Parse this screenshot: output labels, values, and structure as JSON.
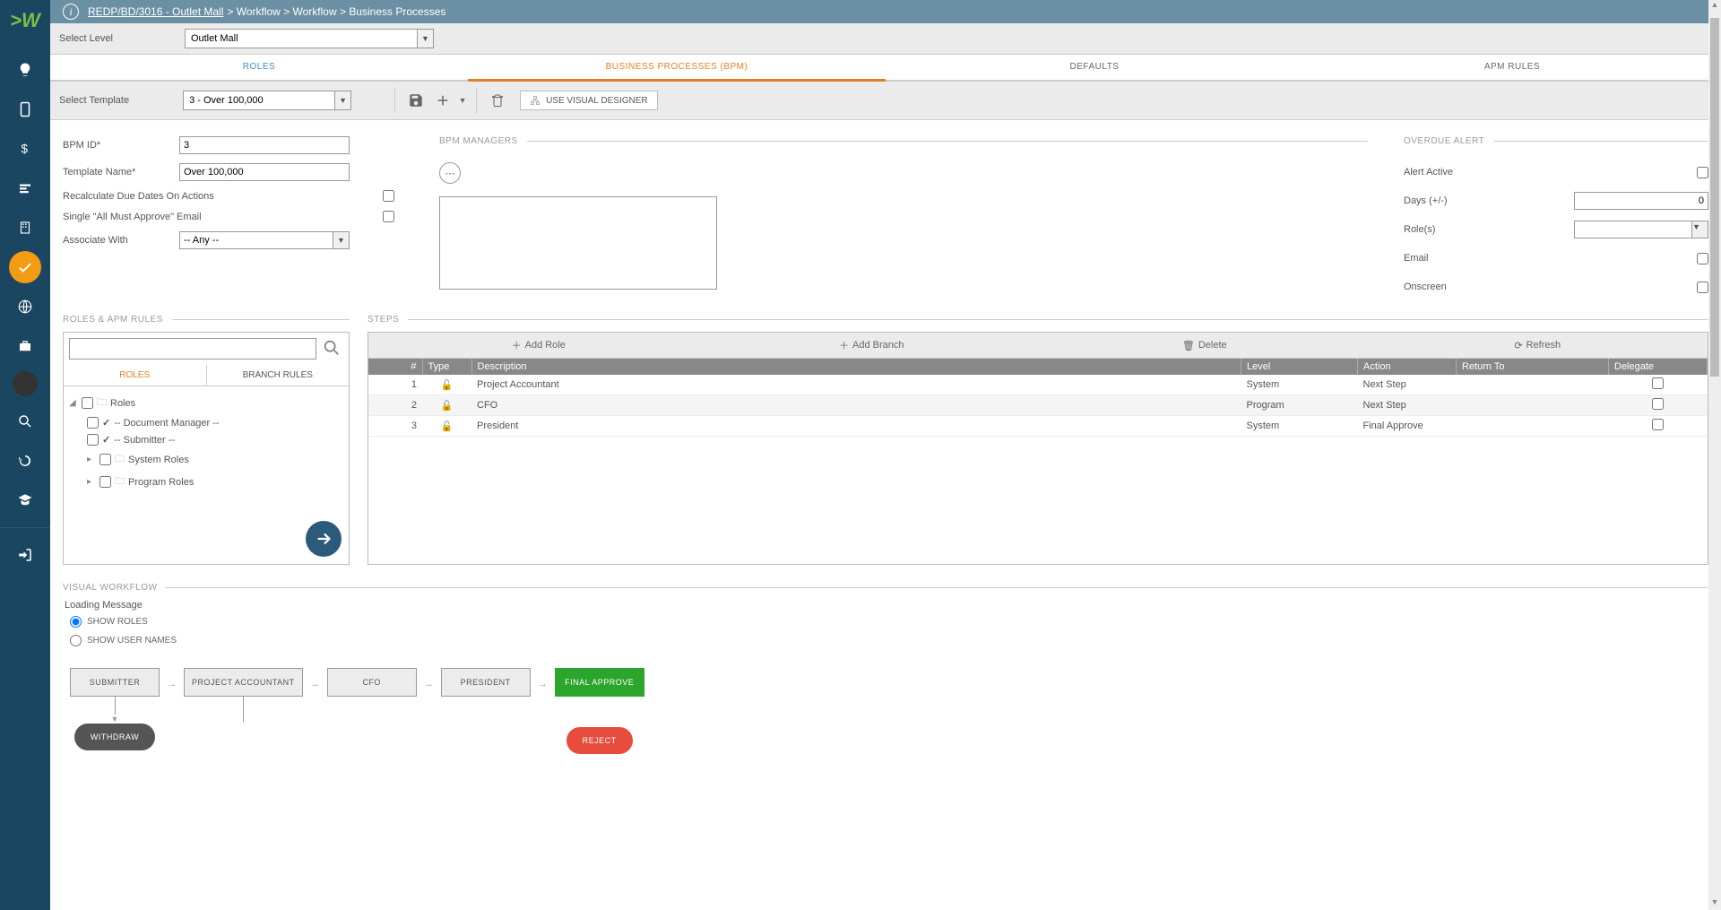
{
  "breadcrumb": {
    "link": "REDP/BD/3016 - Outlet Mall",
    "rest": " > Workflow > Workflow > Business Processes"
  },
  "level": {
    "label": "Select Level",
    "value": "Outlet Mall"
  },
  "tabs": {
    "roles": "ROLES",
    "bpm": "BUSINESS PROCESSES (BPM)",
    "defaults": "DEFAULTS",
    "apm": "APM RULES"
  },
  "toolbar": {
    "template_label": "Select Template",
    "template_value": "3 - Over 100,000",
    "visual_designer": "USE VISUAL DESIGNER"
  },
  "form": {
    "bpm_id_label": "BPM ID*",
    "bpm_id": "3",
    "template_name_label": "Template Name*",
    "template_name": "Over 100,000",
    "recalc_label": "Recalculate Due Dates On Actions",
    "single_label": "Single \"All Must Approve\" Email",
    "associate_label": "Associate With",
    "associate_value": "-- Any --"
  },
  "managers": {
    "title": "BPM MANAGERS"
  },
  "alert": {
    "title": "OVERDUE ALERT",
    "active_label": "Alert Active",
    "days_label": "Days (+/-)",
    "days_value": "0",
    "roles_label": "Role(s)",
    "email_label": "Email",
    "onscreen_label": "Onscreen"
  },
  "roles_panel": {
    "title": "ROLES & APM RULES",
    "tab_roles": "ROLES",
    "tab_branch": "BRANCH RULES",
    "tree": {
      "root": "Roles",
      "doc_mgr": "-- Document Manager --",
      "submitter": "-- Submitter --",
      "system": "System Roles",
      "program": "Program Roles"
    }
  },
  "steps": {
    "title": "STEPS",
    "btn_add_role": "Add Role",
    "btn_add_branch": "Add Branch",
    "btn_delete": "Delete",
    "btn_refresh": "Refresh",
    "headers": {
      "num": "#",
      "type": "Type",
      "desc": "Description",
      "level": "Level",
      "action": "Action",
      "return": "Return To",
      "delegate": "Delegate"
    },
    "rows": [
      {
        "num": "1",
        "desc": "Project Accountant",
        "level": "System",
        "action": "Next Step"
      },
      {
        "num": "2",
        "desc": "CFO",
        "level": "Program",
        "action": "Next Step"
      },
      {
        "num": "3",
        "desc": "President",
        "level": "System",
        "action": "Final Approve"
      }
    ]
  },
  "visual": {
    "title": "VISUAL WORKFLOW",
    "loading": "Loading Message",
    "show_roles": "SHOW ROLES",
    "show_users": "SHOW USER NAMES",
    "nodes": {
      "submitter": "SUBMITTER",
      "pa": "PROJECT ACCOUNTANT",
      "cfo": "CFO",
      "president": "PRESIDENT",
      "final": "FINAL APPROVE",
      "withdraw": "WITHDRAW",
      "reject": "REJECT"
    }
  }
}
